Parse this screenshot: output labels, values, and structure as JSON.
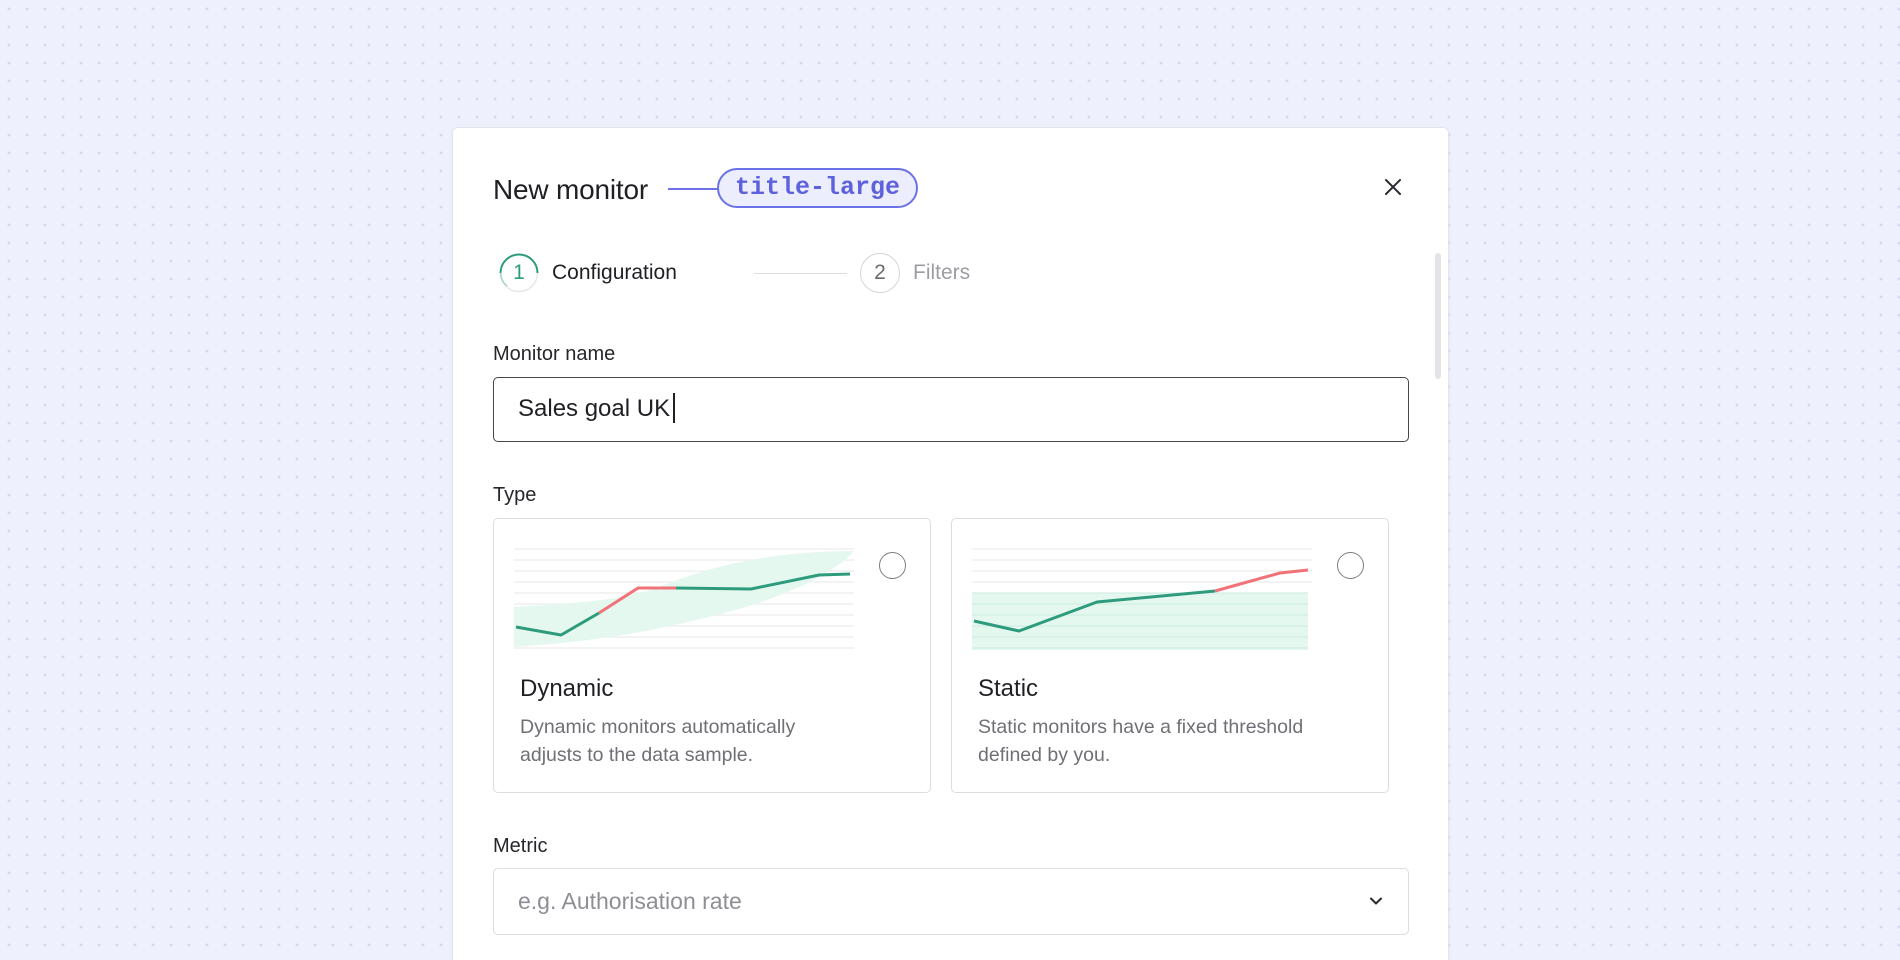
{
  "modal": {
    "title": "New monitor",
    "title_tag": "title-large",
    "close_icon": "close-icon"
  },
  "stepper": {
    "steps": [
      {
        "number": "1",
        "label": "Configuration",
        "state": "active"
      },
      {
        "number": "2",
        "label": "Filters",
        "state": "inactive"
      }
    ]
  },
  "monitor_name": {
    "label": "Monitor name",
    "value": "Sales goal UK"
  },
  "type": {
    "label": "Type",
    "options": [
      {
        "title": "Dynamic",
        "description": "Dynamic monitors automatically adjusts to the data sample.",
        "selected": false
      },
      {
        "title": "Static",
        "description": "Static monitors have a fixed threshold defined by you.",
        "selected": false
      }
    ]
  },
  "metric": {
    "label": "Metric",
    "placeholder": "e.g. Authorisation rate",
    "icon": "chevron-down-icon"
  },
  "colors": {
    "accent": "#6c72e6",
    "line_green": "#2e9c7c",
    "line_red": "#f07379",
    "band_fill": "#e5f8f0"
  }
}
